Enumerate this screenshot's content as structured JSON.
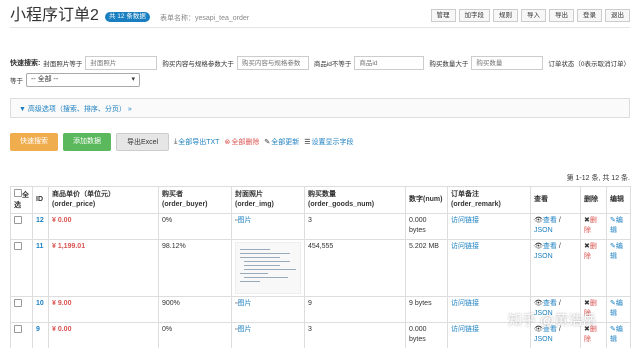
{
  "header": {
    "title": "小程序订单2",
    "count_badge": "共 12 条数据",
    "table_name": "表单名称：yesapi_tea_order",
    "buttons": [
      "管理",
      "加字段",
      "规则",
      "导入",
      "导出",
      "登录",
      "退出"
    ]
  },
  "search": {
    "label": "快速搜索:",
    "cover_label": "封面照片等于",
    "cover_placeholder": "封面照片",
    "content_label": "购买内容与规格参数大于",
    "content_placeholder": "购买内容与规格参数",
    "id_label": "商品id不等于",
    "id_placeholder": "商品id",
    "qty_label": "购买数量大于",
    "qty_placeholder": "购买数量",
    "status_label": "订单状态（0表示取消订单）",
    "equals_label": "等于",
    "select_value": "-- 全部 --"
  },
  "advanced": {
    "label": "高级选项（搜索、排序、分页）"
  },
  "actions": {
    "quick_search": "快速搜索",
    "add": "添加数据",
    "export_excel": "导出Excel",
    "export_txt": "全部导出TXT",
    "delete_all": "全部删除",
    "update_all": "全部更新",
    "display_fields": "设置显示字段"
  },
  "pagination": {
    "info": "第 1-12 条, 共 12 条."
  },
  "table": {
    "headers": {
      "select_all": "全选",
      "id": "ID",
      "price": "商品单价（单位元）(order_price)",
      "buyer": "购买者 (order_buyer)",
      "img": "封面照片 (order_img)",
      "goods_num": "购买数量 (order_goods_num)",
      "num": "数字(num)",
      "remark": "订单备注 (order_remark)",
      "view": "查看",
      "delete": "删除",
      "edit": "编辑"
    },
    "rows": [
      {
        "id": "12",
        "price": "¥ 0.00",
        "buyer": "0%",
        "img": "图片",
        "goods_num": "3",
        "num": "0.000 bytes",
        "remark": "访问链接",
        "view": "查看",
        "json": "JSON",
        "del": "删除",
        "edit": "编辑"
      },
      {
        "id": "11",
        "price": "¥ 1,199.01",
        "buyer": "98.12%",
        "img": "",
        "goods_num": "454,555",
        "num": "5.202 MB",
        "remark": "访问链接",
        "view": "查看",
        "json": "JSON",
        "del": "删除",
        "edit": "编辑"
      },
      {
        "id": "10",
        "price": "¥ 9.00",
        "buyer": "900%",
        "img": "图片",
        "goods_num": "9",
        "num": "9 bytes",
        "remark": "访问链接",
        "view": "查看",
        "json": "JSON",
        "del": "删除",
        "edit": "编辑"
      },
      {
        "id": "9",
        "price": "¥ 0.00",
        "buyer": "0%",
        "img": "图片",
        "goods_num": "3",
        "num": "0.000 bytes",
        "remark": "访问链接",
        "view": "查看",
        "json": "JSON",
        "del": "删除",
        "edit": "编辑"
      }
    ]
  },
  "watermark": "知乎 @黄浩岳"
}
